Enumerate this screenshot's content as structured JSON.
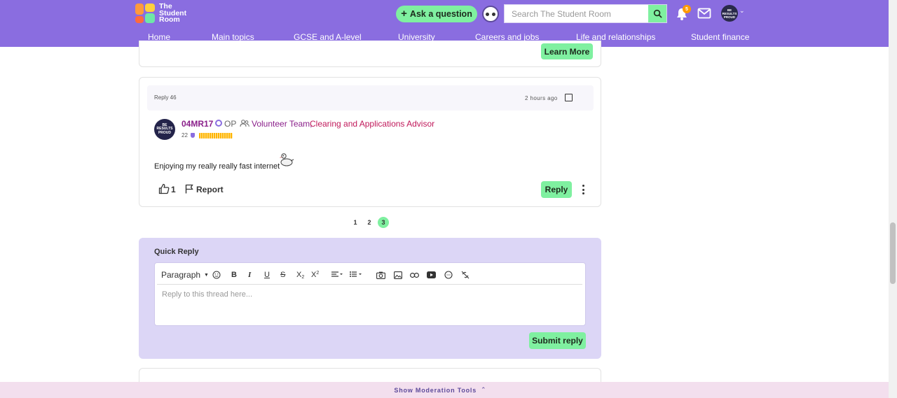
{
  "header": {
    "logo_line1": "The",
    "logo_line2": "Student",
    "logo_line3": "Room",
    "ask_button": "Ask a question",
    "search_placeholder": "Search The Student Room",
    "notification_count": "5",
    "avatar_text": "BE RESULTS PROUD"
  },
  "nav": {
    "items": [
      "Home",
      "Main topics",
      "GCSE and A-level",
      "University",
      "Careers and jobs",
      "Life and relationships",
      "Student finance"
    ]
  },
  "promo": {
    "learn_more": "Learn More"
  },
  "post": {
    "reply_label": "Reply 46",
    "time": "2 hours ago",
    "avatar_text": "BE RESULTS PROUD",
    "username": "04MR17",
    "op_label": "OP",
    "team1": "Volunteer Team,",
    "team2": "Clearing and Applications Advisor",
    "rep": "22",
    "body": "Enjoying my really really fast internet",
    "like_count": "1",
    "report_label": "Report",
    "reply_button": "Reply"
  },
  "pagination": {
    "pages": [
      "1",
      "2",
      "3"
    ],
    "current": "3"
  },
  "quick_reply": {
    "title": "Quick Reply",
    "paragraph_label": "Paragraph",
    "placeholder": "Reply to this thread here...",
    "submit": "Submit reply"
  },
  "moderation": {
    "label": "Show Moderation Tools"
  },
  "colors": {
    "header_purple": "#8a6de0",
    "accent_green": "#7ff0a0",
    "username_purple": "#8a1f8a",
    "advisor_red": "#c0185a",
    "quick_reply_bg": "#dcd6f6"
  }
}
